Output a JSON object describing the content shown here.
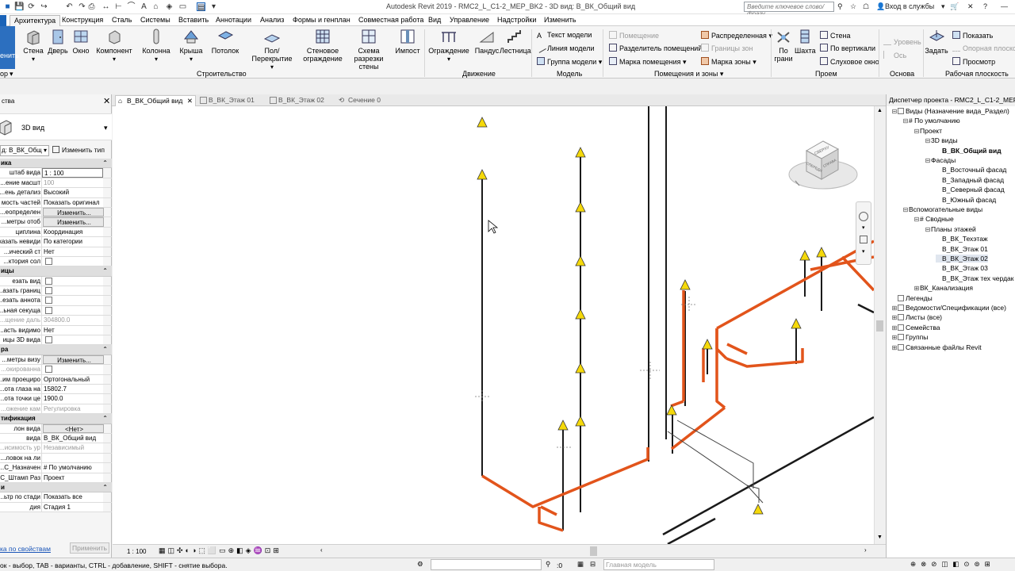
{
  "title": "Autodesk Revit 2019 - RMC2_L_C1-2_MEP_BK2 - 3D вид: В_ВК_Общий вид",
  "search_placeholder": "Введите ключевое слово/фразу",
  "signin": "Вход в службы",
  "ribbon_tabs": [
    "Архитектура",
    "Конструкция",
    "Сталь",
    "Системы",
    "Вставить",
    "Аннотации",
    "Анализ",
    "Формы и генплан",
    "Совместная работа",
    "Вид",
    "Управление",
    "Надстройки",
    "Изменить"
  ],
  "ribbon": {
    "modify_fragment": "енить",
    "modify_fragment2": "ор",
    "build": {
      "buttons": [
        "Стена",
        "Дверь",
        "Окно",
        "Компонент",
        "Колонна",
        "Крыша",
        "Потолок",
        "Пол/Перекрытие",
        "Стеновое ограждение",
        "Схема разрезки стены",
        "Импост"
      ],
      "title": "Строительство"
    },
    "move": {
      "buttons": [
        "Ограждение",
        "Пандус",
        "Лестница"
      ],
      "title": "Движение"
    },
    "model": {
      "items": [
        "Текст модели",
        "Линия модели",
        "Группа модели"
      ],
      "title": "Модель"
    },
    "rooms": {
      "items": [
        "Помещение",
        "Разделитель помещений",
        "Марка помещения",
        "Распределенная",
        "Границы зон",
        "Марка зоны"
      ],
      "title": "Помещения и зоны"
    },
    "opening": {
      "buttons": [
        "По грани",
        "Шахта"
      ],
      "items": [
        "Стена",
        "По вертикали",
        "Слуховое окно"
      ],
      "title": "Проем"
    },
    "datum": {
      "items": [
        "Уровень",
        "Ось"
      ],
      "title": "Основа"
    },
    "workplane": {
      "button": "Задать",
      "items": [
        "Показать",
        "Опорная плоскость",
        "Просмотр"
      ],
      "title": "Рабочая плоскость"
    }
  },
  "properties": {
    "title": "ства",
    "type": "3D вид",
    "selector": "д: В_ВК_Общ",
    "edit_type": "Изменить тип",
    "groups": [
      {
        "name": "ика",
        "rows": [
          {
            "k": "штаб вида",
            "v": "1 : 100",
            "style": "boxed"
          },
          {
            "k": "ение масшт...",
            "v": "100",
            "dis": true
          },
          {
            "k": "ень детализ...",
            "v": "Высокий"
          },
          {
            "k": "мость частей",
            "v": "Показать оригинал"
          },
          {
            "k": "еопределен...",
            "v": "Изменить...",
            "style": "btn"
          },
          {
            "k": "метры отоб...",
            "v": "Изменить...",
            "style": "btn"
          },
          {
            "k": "циплина",
            "v": "Координация"
          },
          {
            "k": "казать невиди...",
            "v": "По категории"
          },
          {
            "k": "ический ст...",
            "v": "Нет"
          },
          {
            "k": "ктория сол...",
            "v": "",
            "chk": true
          }
        ]
      },
      {
        "name": "ицы",
        "rows": [
          {
            "k": "езать вид",
            "v": "",
            "chk": true
          },
          {
            "k": "азать границ...",
            "v": "",
            "chk": true
          },
          {
            "k": "езать аннота...",
            "v": "",
            "chk": true
          },
          {
            "k": "ьная секуща...",
            "v": "",
            "chk": true
          },
          {
            "k": "щение даль...",
            "v": "304800.0",
            "dis": true,
            "kdis": true
          },
          {
            "k": "асть видимо...",
            "v": "Нет"
          },
          {
            "k": "ицы 3D вида",
            "v": "",
            "chk": true
          }
        ]
      },
      {
        "name": "ра",
        "rows": [
          {
            "k": "метры визу...",
            "v": "Изменить...",
            "style": "btn"
          },
          {
            "k": "окированна...",
            "v": "",
            "chk": true,
            "kdis": true
          },
          {
            "k": "им проециро...",
            "v": "Ортогональный"
          },
          {
            "k": "ота глаза на...",
            "v": "15802.7"
          },
          {
            "k": "ота точки це...",
            "v": "1900.0"
          },
          {
            "k": "ожение кам...",
            "v": "Регулировка",
            "dis": true,
            "kdis": true
          }
        ]
      },
      {
        "name": "тификация",
        "rows": [
          {
            "k": "лон вида",
            "v": "<Нет>",
            "style": "btn"
          },
          {
            "k": " вида",
            "v": "В_ВК_Общий вид"
          },
          {
            "k": "исимость ур...",
            "v": "Независимый",
            "dis": true,
            "kdis": true
          },
          {
            "k": "ловок на ли...",
            "v": ""
          },
          {
            "k": "С_Назначен...",
            "v": "# По умолчанию"
          },
          {
            "k": "С_Штамп Раз...",
            "v": "Проект"
          }
        ]
      },
      {
        "name": "и",
        "rows": [
          {
            "k": "ьтр по стади...",
            "v": "Показать все"
          },
          {
            "k": "дия",
            "v": "Стадия 1"
          }
        ]
      }
    ],
    "help_link": "ка по свойствам",
    "apply": "Применить"
  },
  "view_tabs": [
    "В_ВК_Общий вид",
    "В_ВК_Этаж 01",
    "В_ВК_Этаж 02",
    "Сечение 0"
  ],
  "view_scale": "1 : 100",
  "browser": {
    "title": "Диспетчер проекта - RMC2_L_C1-2_MEP_BK2",
    "nodes": [
      {
        "label": "Виды (Назначение вида_Раздел)",
        "level": 0,
        "tog": "−"
      },
      {
        "label": "# По умолчанию",
        "level": 1,
        "tog": "−"
      },
      {
        "label": "Проект",
        "level": 2,
        "tog": "−"
      },
      {
        "label": "3D виды",
        "level": 3,
        "tog": "−"
      },
      {
        "label": "В_ВК_Общий вид",
        "level": 4,
        "bold": true
      },
      {
        "label": "Фасады",
        "level": 3,
        "tog": "−"
      },
      {
        "label": "В_Восточный фасад",
        "level": 4
      },
      {
        "label": "В_Западный фасад",
        "level": 4
      },
      {
        "label": "В_Северный фасад",
        "level": 4
      },
      {
        "label": "В_Южный фасад",
        "level": 4
      },
      {
        "label": "Вспомогательные виды",
        "level": 1,
        "tog": "−"
      },
      {
        "label": "# Сводные",
        "level": 2,
        "tog": "−"
      },
      {
        "label": "Планы этажей",
        "level": 3,
        "tog": "−"
      },
      {
        "label": "В_ВК_Техэтаж",
        "level": 4
      },
      {
        "label": "В_ВК_Этаж 01",
        "level": 4
      },
      {
        "label": "В_ВК_Этаж 02",
        "level": 4,
        "sel": true
      },
      {
        "label": "В_ВК_Этаж 03",
        "level": 4
      },
      {
        "label": "В_ВК_Этаж тех чердак",
        "level": 4
      },
      {
        "label": "ВК_Канализация",
        "level": 2,
        "tog": "+"
      },
      {
        "label": "Легенды",
        "level": 0
      },
      {
        "label": "Ведомости/Спецификации (все)",
        "level": 0,
        "tog": "+"
      },
      {
        "label": "Листы (все)",
        "level": 0,
        "tog": "+"
      },
      {
        "label": "Семейства",
        "level": 0,
        "tog": "+"
      },
      {
        "label": "Группы",
        "level": 0,
        "tog": "+"
      },
      {
        "label": "Связанные файлы Revit",
        "level": 0,
        "tog": "+"
      }
    ]
  },
  "viewcube": {
    "top": "СВЕРХУ",
    "front": "СПЕРЕДИ",
    "right": "СПРАВА"
  },
  "status": {
    "hint": "ок - выбор, TAB - варианты, CTRL - добавление, SHIFT - снятие выбора.",
    "count": ":0",
    "model": "Главная модель"
  },
  "colors": {
    "pipe_orange": "#e2541b",
    "pipe_black": "#1a1a1a",
    "accent_blue": "#1a63b8",
    "warning_yellow": "#f5d90a"
  }
}
